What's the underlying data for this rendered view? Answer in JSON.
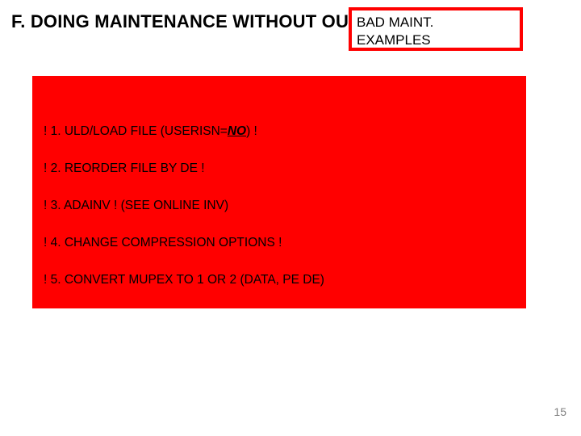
{
  "title": "F. DOING MAINTENANCE WITHOUT OU",
  "callout": {
    "line1": "BAD MAINT.",
    "line2": "EXAMPLES"
  },
  "list": {
    "item1_pre": "! 1. ULD/LOAD FILE (USERISN=",
    "item1_em": "NO",
    "item1_post": ") !",
    "item2": "! 2. REORDER FILE BY DE !",
    "item3": "! 3. ADAINV !   (SEE ONLINE INV)",
    "item4": "! 4. CHANGE COMPRESSION OPTIONS !",
    "item5": "! 5.  CONVERT MUPEX TO 1 OR 2 (DATA, PE DE)"
  },
  "page_number": "15"
}
